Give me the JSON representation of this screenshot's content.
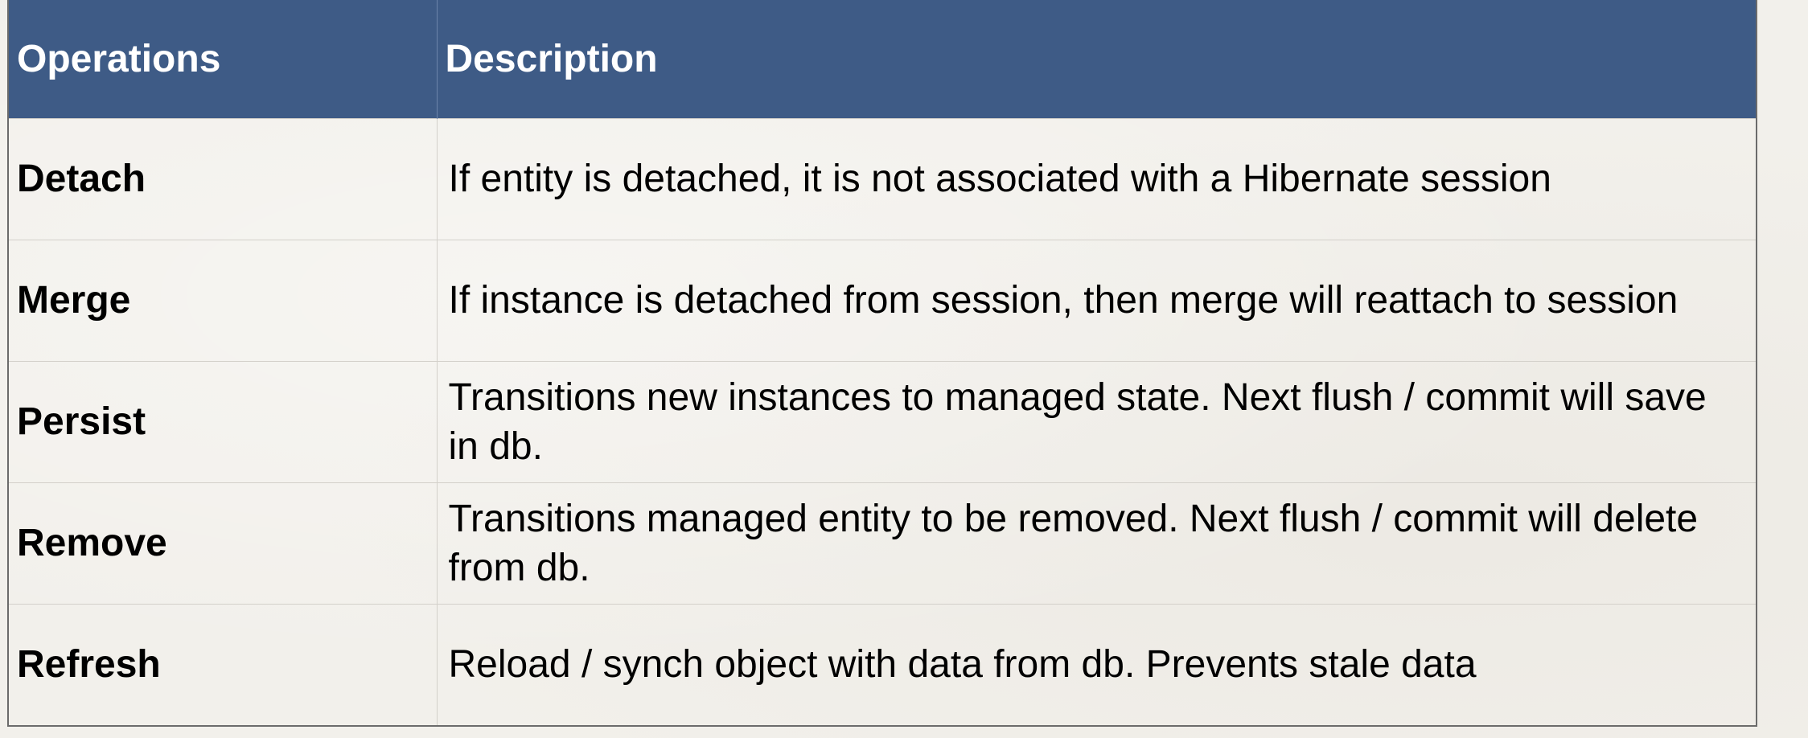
{
  "table": {
    "headers": [
      "Operations",
      "Description"
    ],
    "rows": [
      {
        "operation": "Detach",
        "description": "If entity is detached, it is not associated with a Hibernate session"
      },
      {
        "operation": "Merge",
        "description": "If instance is detached from session, then merge will reattach to session"
      },
      {
        "operation": "Persist",
        "description": "Transitions new instances to managed state. Next flush / commit will save in db."
      },
      {
        "operation": "Remove",
        "description": "Transitions managed entity to be removed. Next flush / commit will delete from db."
      },
      {
        "operation": "Refresh",
        "description": "Reload / synch object with data from db. Prevents stale data"
      }
    ]
  },
  "colors": {
    "header_background": "#3e5b86",
    "header_text": "#ffffff",
    "page_background": "#f2f0eb",
    "body_text": "#000000"
  }
}
